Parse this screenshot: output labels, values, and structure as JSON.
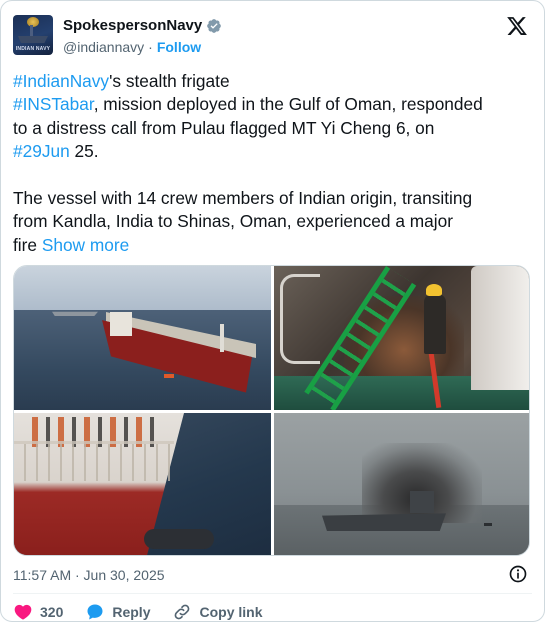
{
  "author": {
    "display_name": "SpokespersonNavy",
    "handle": "@indiannavy",
    "separator": "·",
    "follow_label": "Follow",
    "avatar_text": "INDIAN NAVY",
    "verified_color": "#829aab"
  },
  "tweet": {
    "lines": [
      [
        {
          "t": "#IndianNavy",
          "tag": true
        },
        {
          "t": "'s stealth frigate",
          "tag": false
        }
      ],
      [
        {
          "t": "#INSTabar",
          "tag": true
        },
        {
          "t": ", mission deployed in the Gulf of Oman, responded",
          "tag": false
        }
      ],
      [
        {
          "t": "to a distress call from Pulau flagged MT Yi Cheng 6, on",
          "tag": false
        }
      ],
      [
        {
          "t": "#29Jun",
          "tag": true
        },
        {
          "t": " 25.",
          "tag": false
        }
      ],
      [],
      [
        {
          "t": "The vessel with 14 crew members of Indian origin, transiting",
          "tag": false
        }
      ],
      [
        {
          "t": "from Kandla, India to Shinas, Oman, experienced a major",
          "tag": false
        }
      ],
      [
        {
          "t": "fire ",
          "tag": false
        },
        {
          "t": "Show more",
          "tag": true,
          "more": true
        }
      ]
    ],
    "link_color": "#1d9bf0"
  },
  "media": {
    "photos": [
      "tanker-at-sea-photo",
      "firefighter-on-deck-photo",
      "ship-side-rescue-photo",
      "smoking-ship-photo"
    ]
  },
  "meta": {
    "timestamp": "11:57 AM · Jun 30, 2025"
  },
  "actions": {
    "like_count": "320",
    "reply_label": "Reply",
    "copy_link_label": "Copy link",
    "like_color": "#f91880",
    "reply_color": "#1d9bf0"
  }
}
